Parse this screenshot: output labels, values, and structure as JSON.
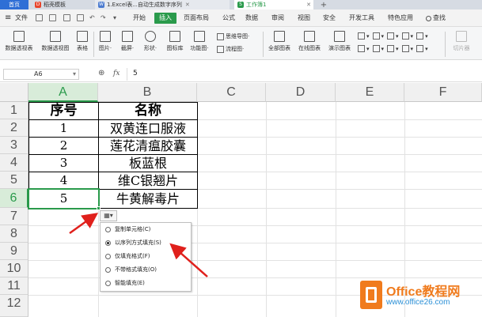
{
  "titlebar": {
    "tabs": [
      {
        "label": "首页",
        "color": "#2f6fd6"
      },
      {
        "label": "稻壳模板",
        "color": "#e8452c"
      },
      {
        "label": "1.Excel表...自动生成数字序列",
        "color": "#4b7bd0"
      },
      {
        "label": "工作簿1",
        "color": "#2a9a4b"
      }
    ],
    "new_tab": "+"
  },
  "menubar": {
    "file": "文件",
    "items": [
      "开始",
      "插入",
      "页面布局",
      "公式",
      "数据",
      "审阅",
      "视图",
      "安全",
      "开发工具",
      "特色应用"
    ],
    "active": "插入",
    "search": "查找"
  },
  "ribbon": {
    "buttons": [
      "数据透视表",
      "数据透视图",
      "表格",
      "图片·",
      "截屏·",
      "形状·",
      "图标库",
      "功能图·",
      "全部图表",
      "在线图表",
      "演示图表",
      "切片器"
    ],
    "small": [
      "思维导图·",
      "流程图·"
    ]
  },
  "formula_bar": {
    "cell_ref": "A6",
    "fx": "fx",
    "value": "5"
  },
  "sheet": {
    "columns": [
      "A",
      "B",
      "C",
      "D",
      "E",
      "F"
    ],
    "rows": [
      "1",
      "2",
      "3",
      "4",
      "5",
      "6",
      "7",
      "8",
      "9",
      "10",
      "11",
      "12"
    ],
    "header": {
      "a": "序号",
      "b": "名称"
    },
    "data": [
      {
        "a": "1",
        "b": "双黄连口服液"
      },
      {
        "a": "2",
        "b": "莲花清瘟胶囊"
      },
      {
        "a": "3",
        "b": "板蓝根"
      },
      {
        "a": "4",
        "b": "维C银翘片"
      },
      {
        "a": "5",
        "b": "牛黄解毒片"
      }
    ]
  },
  "autofill": {
    "options": [
      "复制单元格(C)",
      "以序列方式填充(S)",
      "仅填充格式(F)",
      "不带格式填充(O)",
      "智能填充(E)"
    ],
    "selected_index": 1
  },
  "watermark": {
    "name_part1": "Office",
    "name_part2": "教程网",
    "url": "www.office26.com"
  },
  "colors": {
    "accent": "#2a9a4b",
    "arrow": "#e0201c",
    "watermark_orange": "#f07b1d"
  }
}
